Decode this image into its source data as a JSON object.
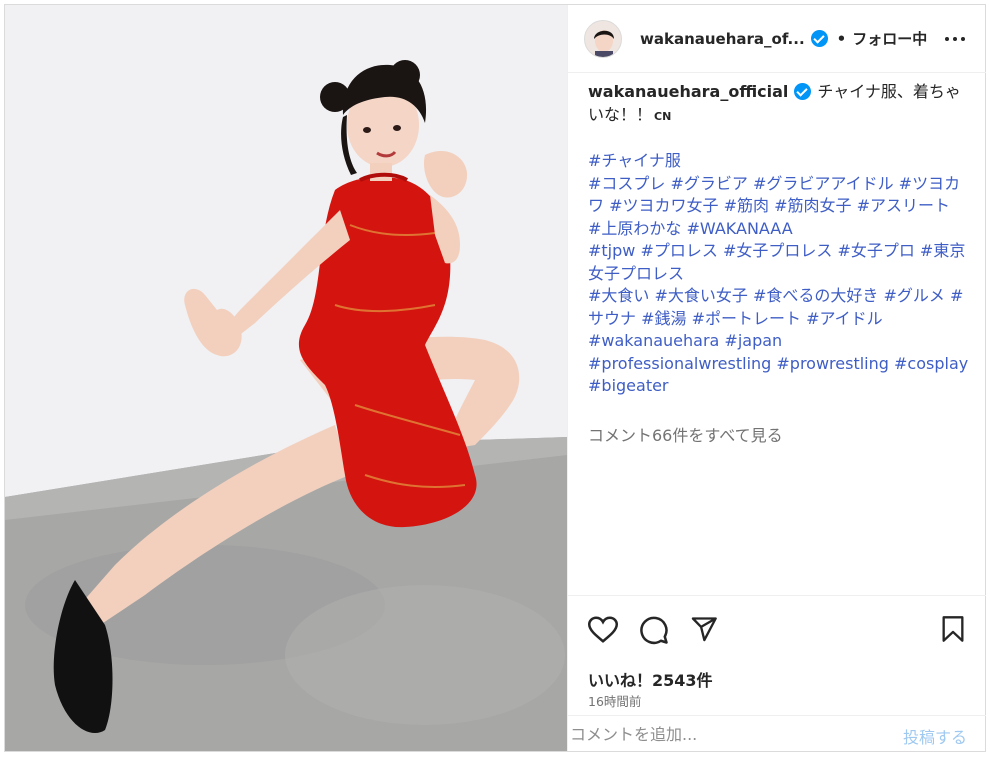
{
  "header": {
    "username": "wakanauehara_of...",
    "separator": "•",
    "follow_label": "フォロー中"
  },
  "caption": {
    "username": "wakanauehara_official",
    "text": "チャイナ服、着ちゃいな！！",
    "badge": "CN",
    "hashtag_lines": [
      "#チャイナ服",
      "#コスプレ #グラビア #グラビアアイドル #ツヨカワ #ツヨカワ女子 #筋肉 #筋肉女子 #アスリート",
      "#上原わかな #WAKANAAA",
      "#tjpw #プロレス #女子プロレス #女子プロ #東京女子プロレス",
      "#大食い #大食い女子 #食べるの大好き #グルメ #サウナ #銭湯 #ポートレート #アイドル",
      "#wakanauehara #japan",
      "#professionalwrestling #prowrestling #cosplay",
      "#bigeater"
    ]
  },
  "comments_link": "コメント66件をすべて見る",
  "likes": "いいね！2543件",
  "timestamp": "16時間前",
  "comment_box": {
    "placeholder": "コメントを追加...",
    "post_label": "投稿する"
  },
  "icons": [
    "heart-icon",
    "comment-icon",
    "share-icon",
    "bookmark-icon",
    "more-icon",
    "verified-badge-icon"
  ],
  "colors": {
    "hashtag": "#3f5ec5",
    "verified": "#0095f6",
    "post_disabled": "#9fc9f0",
    "dress": "#d4140f"
  }
}
